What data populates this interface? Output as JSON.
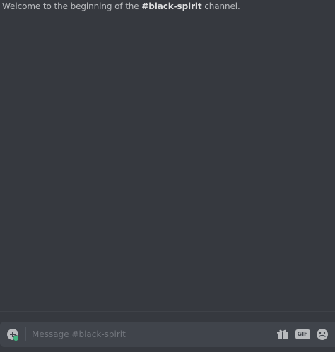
{
  "welcome": {
    "prefix": "Welcome to the beginning of the ",
    "channel": "#black-spirit",
    "suffix": " channel."
  },
  "composer": {
    "placeholder": "Message #black-spirit",
    "value": "",
    "gif_label": "GIF"
  },
  "icons": {
    "upload": "plus-circle-icon",
    "gift": "gift-icon",
    "gif": "gif-icon",
    "emoji": "emoji-icon"
  },
  "colors": {
    "background": "#36393f",
    "input_background": "#40444b",
    "status_green": "#43b581",
    "muted_text": "#72767d"
  }
}
